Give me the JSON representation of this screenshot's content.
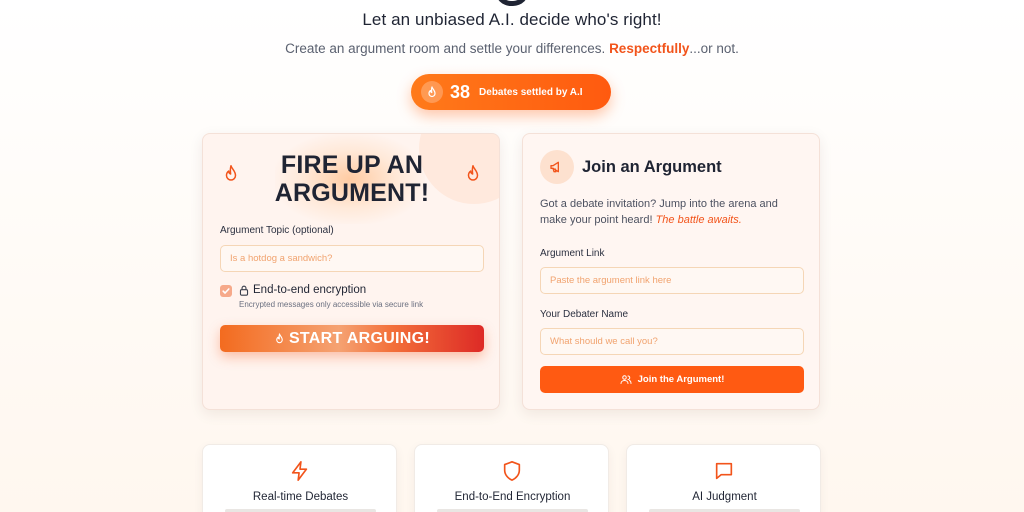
{
  "hero": {
    "tagline": "Let an unbiased A.I. decide who's right!",
    "subline_before": "Create an argument room and settle your differences. ",
    "subline_accent": "Respectfully",
    "subline_after": "...or not."
  },
  "stat": {
    "icon": "flame-icon",
    "count": "38",
    "label": "Debates settled by A.I"
  },
  "create_card": {
    "title": "FIRE UP AN ARGUMENT!",
    "topic_label": "Argument Topic (optional)",
    "topic_placeholder": "Is a hotdog a sandwich?",
    "topic_value": "",
    "encryption_checked": true,
    "encryption_label": "End-to-end encryption",
    "encryption_note": "Encrypted messages only accessible via secure link",
    "start_label": "START ARGUING!"
  },
  "join_card": {
    "icon": "megaphone-icon",
    "title": "Join an Argument",
    "desc_text": "Got a debate invitation? Jump into the arena and make your point heard! ",
    "desc_accent": "The battle awaits.",
    "link_label": "Argument Link",
    "link_placeholder": "Paste the argument link here",
    "name_label": "Your Debater Name",
    "name_placeholder": "What should we call you?",
    "join_label": "Join the Argument!"
  },
  "features": [
    {
      "icon": "lightning-icon",
      "title": "Real-time Debates"
    },
    {
      "icon": "shield-icon",
      "title": "End-to-End Encryption"
    },
    {
      "icon": "chat-bubble-icon",
      "title": "AI Judgment"
    }
  ],
  "colors": {
    "accent": "#ff5a12",
    "accent_text": "#f2541b",
    "card_bg": "#fff4ef"
  }
}
